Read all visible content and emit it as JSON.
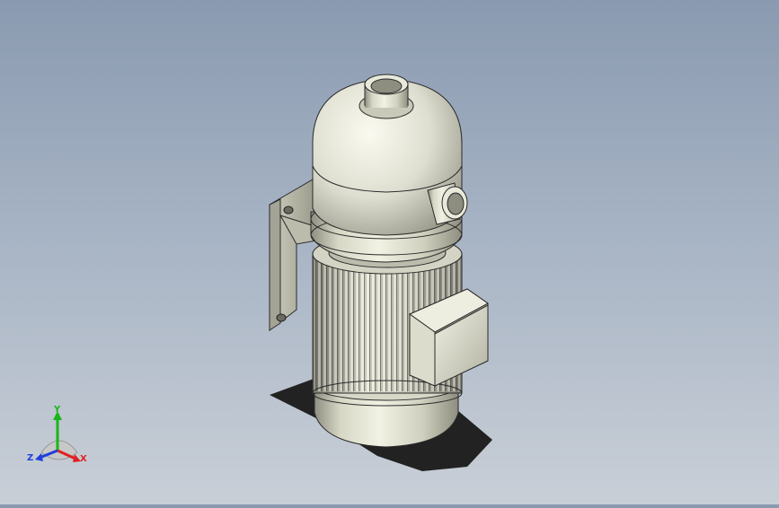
{
  "triad": {
    "x_label": "X",
    "y_label": "Y",
    "z_label": "Z",
    "x_color": "#e02020",
    "y_color": "#19b619",
    "z_color": "#1e3fdc"
  },
  "colors": {
    "background_top": "#8a9ab0",
    "background_bottom": "#c9cfd7",
    "part_body": "#e2e2d2",
    "part_shadow": "#222222"
  },
  "model": {
    "parts": [
      "dome-cover",
      "inlet-nozzle",
      "side-outlet-nozzle",
      "mounting-bracket",
      "motor-housing",
      "cooling-fins",
      "terminal-box",
      "end-cap"
    ]
  }
}
